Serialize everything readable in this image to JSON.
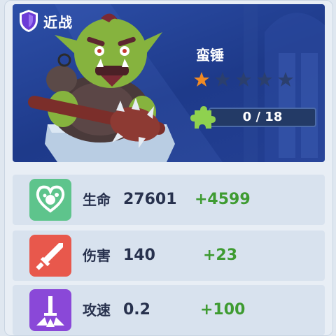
{
  "unit": {
    "class_label": "近战",
    "name": "蛮锤",
    "stars_filled": 1,
    "stars_total": 5,
    "star_color_filled": "#f08a24",
    "star_color_empty": "#2b3f6e",
    "shard_progress_text": "0 / 18",
    "shard_current": 0,
    "shard_required": 18,
    "shard_icon": "puzzle-icon",
    "class_icon": "shield-icon"
  },
  "stats": [
    {
      "label": "生命",
      "value": "27601",
      "bonus": "+4599",
      "icon": "heart-icon",
      "icon_color": "#5ec48c"
    },
    {
      "label": "伤害",
      "value": "140",
      "bonus": "+23",
      "icon": "sword-icon",
      "icon_color": "#e8584c"
    },
    {
      "label": "攻速",
      "value": "0.2",
      "bonus": "+100",
      "icon": "attack-speed-icon",
      "icon_color": "#8a48d8"
    }
  ],
  "colors": {
    "hero_bg": "#1e3a8a",
    "bonus_text": "#3e9b31",
    "value_text": "#27314d",
    "shard_accent": "#8fd14f"
  }
}
